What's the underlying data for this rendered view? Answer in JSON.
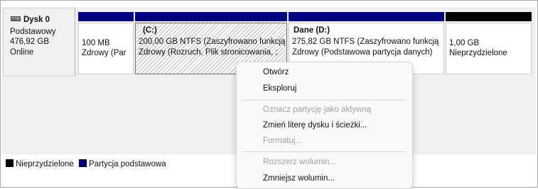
{
  "disk": {
    "name": "Dysk 0",
    "type": "Podstawowy",
    "size": "476,92 GB",
    "status": "Online"
  },
  "partitions": [
    {
      "title": "",
      "line1": "100 MB",
      "line2": "Zdrowy (Par"
    },
    {
      "title": "(C:)",
      "line1": "200,00 GB NTFS (Zaszyfrowano funkcją",
      "line2": "Zdrowy (Rozruch, Plik stronicowania, ;"
    },
    {
      "title": "Dane  (D:)",
      "line1": "275,82 GB NTFS (Zaszyfrowano funkcją",
      "line2": "Zdrowy (Podstawowa partycja danych)"
    },
    {
      "title": "",
      "line1": "1,00 GB",
      "line2": "Nieprzydzielone"
    }
  ],
  "legend": {
    "unallocated": "Nieprzydzielone",
    "primary": "Partycja podstawowa"
  },
  "context_menu": {
    "open": "Otwórz",
    "explore": "Eksploruj",
    "mark_active": "Oznacz partycję jako aktywną",
    "change_letter": "Zmień literę dysku i ścieżki...",
    "format": "Formatuj...",
    "extend": "Rozszerz wolumin...",
    "shrink": "Zmniejsz wolumin..."
  },
  "colors": {
    "primary_partition": "#000080",
    "unallocated": "#000000"
  }
}
